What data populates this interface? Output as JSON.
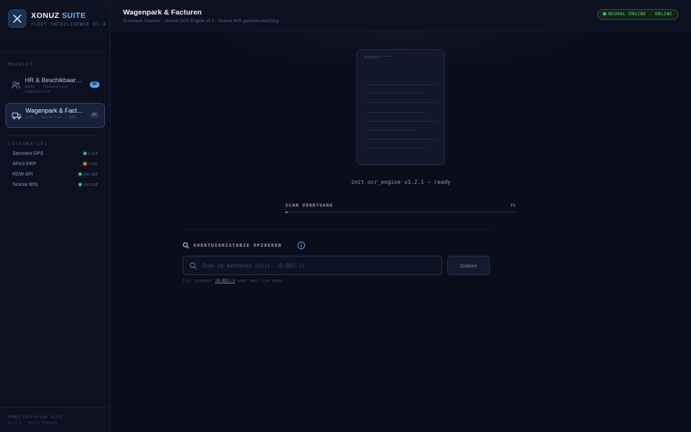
{
  "app": {
    "name": "XONUZ",
    "name_accent": "SUITE",
    "subtitle": "FLEET INTELLIGENCE V1.4"
  },
  "sidebar": {
    "modules_label": "MODULES",
    "modules": [
      {
        "title": "HR & Beschikbaarheid",
        "subtitle": "AVAS · Tachograaf · Capaciteit",
        "badge": "80",
        "active": false
      },
      {
        "title": "Wagenpark & Facturen",
        "subtitle": "OCR · Garantie · WMS",
        "badge": "AI",
        "active": true
      }
    ],
    "integrations_label": "INTEGRATIES",
    "integrations": [
      {
        "name": "Samsara GPS",
        "status": "LIVE",
        "color": "#43d17a"
      },
      {
        "name": "AFAS ERP",
        "status": "SYNC",
        "color": "#e0a630"
      },
      {
        "name": "RDW API",
        "status": "ONLINE",
        "color": "#43d17a"
      },
      {
        "name": "Scania WIS",
        "status": "ONLINE",
        "color": "#43d17a"
      }
    ],
    "footer_line1": "XONUZ Enterprise Suite",
    "footer_line2": "v1.4.1 · build 0419a2c"
  },
  "header": {
    "title": "Wagenpark & Facturen",
    "subtitle": "AI Invoice Scanner · Neural OCR Engine v3.2 · Scania WIS garantie-matching",
    "engine_status": "NEURAL ENGINE · ONLINE"
  },
  "scanner": {
    "doc_header": "#INVOICE",
    "init_message": "init ocr_engine v3.2.1 — ready",
    "progress_label": "SCAN VOORTGANG",
    "progress_value": "1%",
    "progress_fraction": 0.01
  },
  "lookup": {
    "title": "VOERTUIGHISTORIE OPZOEKEN",
    "placeholder": "Zoek op kenteken (bijv. 10-BDJ-3)",
    "button_label": "Zoeken",
    "hint_prefix": "Tip: probeer",
    "hint_example": "10-BDJ-3",
    "hint_suffix": "voor een live demo."
  },
  "icons": {
    "logo": "close-x-icon",
    "hr_module": "users-icon",
    "fleet_module": "truck-icon",
    "search": "search-icon",
    "info": "info-icon"
  },
  "colors": {
    "accent": "#5aa0e8",
    "online": "#43d17a",
    "sync": "#e0a630",
    "background": "#0a0d1a"
  }
}
